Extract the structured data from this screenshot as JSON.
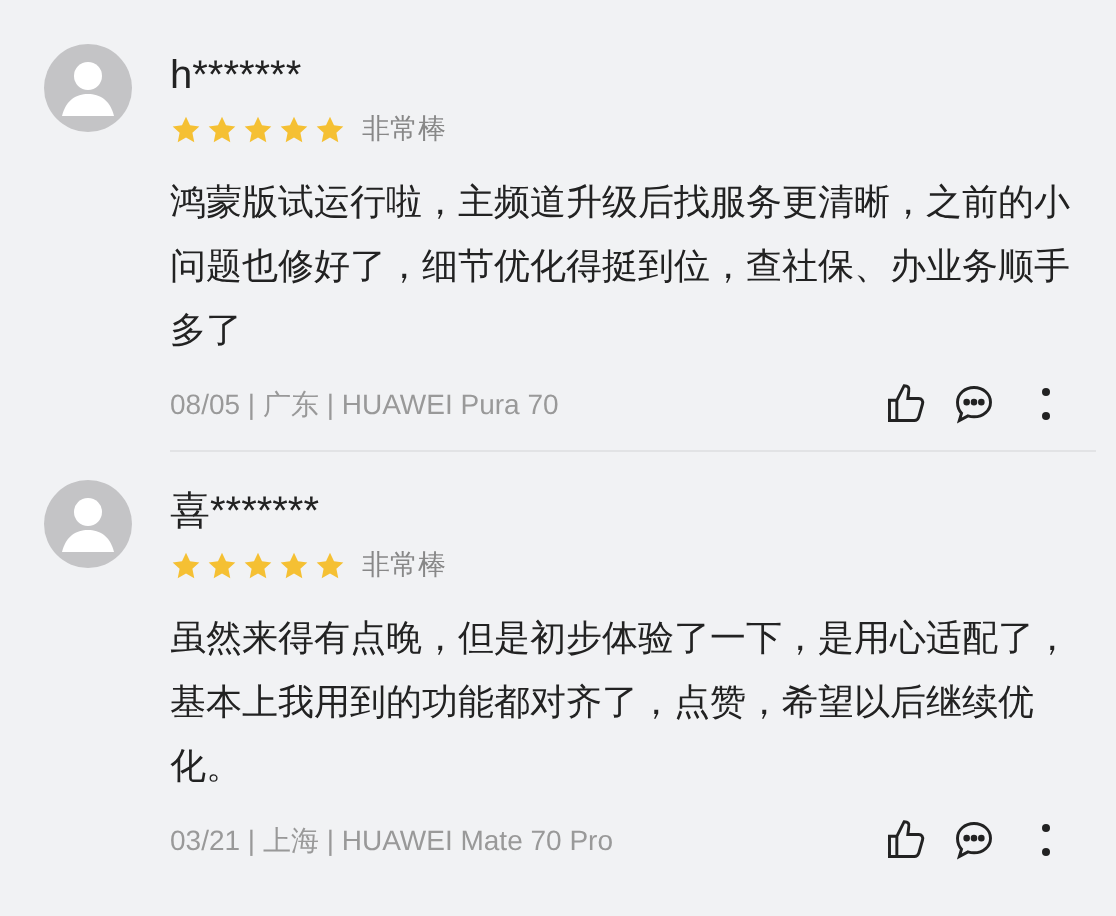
{
  "reviews": [
    {
      "user": "h*******",
      "stars": 5,
      "rating_label": "非常棒",
      "text": "鸿蒙版试运行啦，主频道升级后找服务更清晰，之前的小问题也修好了，细节优化得挺到位，查社保、办业务顺手多了",
      "meta": "08/05 | 广东 | HUAWEI Pura 70"
    },
    {
      "user": "喜*******",
      "stars": 5,
      "rating_label": "非常棒",
      "text": "虽然来得有点晚，但是初步体验了一下，是用心适配了，基本上我用到的功能都对齐了，点赞，希望以后继续优化。",
      "meta": "03/21 | 上海 | HUAWEI Mate 70 Pro"
    }
  ]
}
